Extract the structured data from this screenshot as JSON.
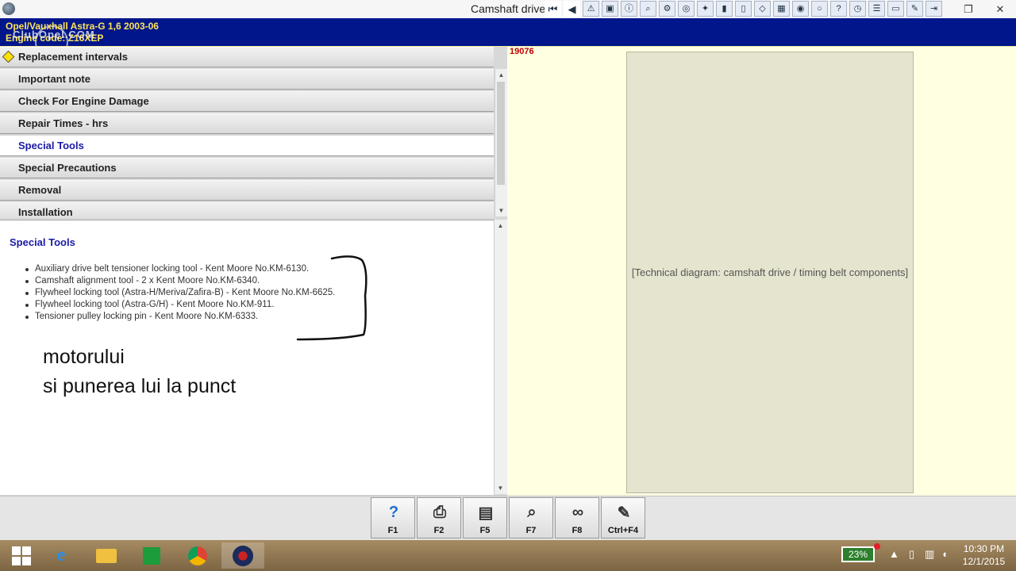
{
  "window": {
    "title": "Camshaft drive",
    "controls": [
      "restore-icon",
      "close-icon"
    ]
  },
  "toolbar": {
    "icons": [
      "first-page-icon",
      "back-icon",
      "warning-icon",
      "print-screen-icon",
      "info-icon",
      "search-icon",
      "tools-icon",
      "engine-icon",
      "wrench-icon",
      "bookmark-icon",
      "battery-icon",
      "parts-icon",
      "chip-icon",
      "oil-icon",
      "tyre-icon",
      "help-icon",
      "clock-icon",
      "settings-icon",
      "car-icon",
      "notes-icon",
      "exit-icon"
    ]
  },
  "vehicle": {
    "line1": "Opel/Vauxhall     Astra-G  1,6  2003-06",
    "line2": "Engine code: Z16XEP",
    "logo_text": "ClubOpel.COM"
  },
  "menu": {
    "items": [
      {
        "label": "Replacement intervals"
      },
      {
        "label": "Important note"
      },
      {
        "label": "Check For Engine Damage"
      },
      {
        "label": "Repair Times - hrs"
      },
      {
        "label": "Special Tools"
      },
      {
        "label": "Special Precautions"
      },
      {
        "label": "Removal"
      },
      {
        "label": "Installation"
      }
    ],
    "selected_index": 4
  },
  "content": {
    "heading": "Special Tools",
    "tools": [
      "Auxiliary drive belt tensioner locking tool - Kent Moore No.KM-6130.",
      "Camshaft alignment tool - 2 x Kent Moore No.KM-6340.",
      "Flywheel locking tool (Astra-H/Meriva/Zafira-B) - Kent Moore No.KM-6625.",
      "Flywheel locking tool (Astra-G/H) - Kent Moore No.KM-911.",
      "Tensioner pulley locking pin - Kent Moore No.KM-6333."
    ],
    "annotation": [
      "motorului",
      "si punerea lui la punct"
    ]
  },
  "diagram": {
    "id": "19076",
    "placeholder": "[Technical diagram: camshaft drive / timing belt components]"
  },
  "function_keys": [
    {
      "label": "F1",
      "icon": "help-icon",
      "glyph": "?"
    },
    {
      "label": "F2",
      "icon": "print-icon",
      "glyph": "⎙"
    },
    {
      "label": "F5",
      "icon": "book-icon",
      "glyph": "▤"
    },
    {
      "label": "F7",
      "icon": "zoom-diagram-icon",
      "glyph": "⌕"
    },
    {
      "label": "F8",
      "icon": "belt-icon",
      "glyph": "∞"
    },
    {
      "label": "Ctrl+F4",
      "icon": "notes-icon",
      "glyph": "✎"
    }
  ],
  "taskbar": {
    "apps": [
      "start-icon",
      "internet-explorer-icon",
      "file-explorer-icon",
      "store-icon",
      "chrome-icon",
      "autodata-icon"
    ],
    "battery_percent": "23%",
    "time": "10:30 PM",
    "date": "12/1/2015"
  }
}
